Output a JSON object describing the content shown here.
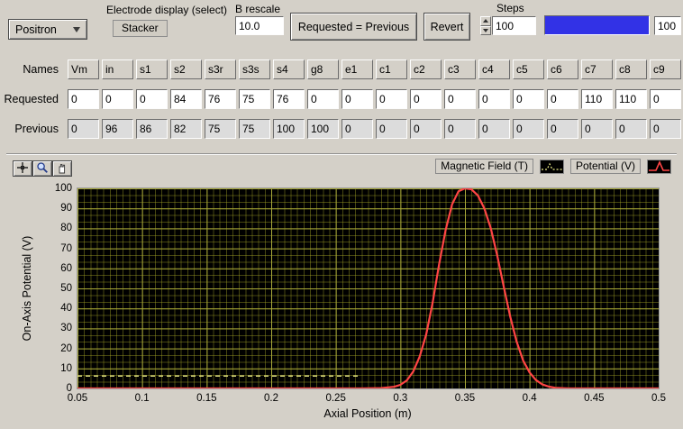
{
  "colors": {
    "panel_bg": "#d4d0c8",
    "plot_bg": "#000000",
    "grid_major": "#a9a93a",
    "grid_minor": "#5c5c14",
    "slider_blue": "#3232e6",
    "potential_red": "#ff4545",
    "bfield_yellow": "#f0f08c"
  },
  "top": {
    "particle_selector": "Positron",
    "electrode_display_label": "Electrode display (select)",
    "electrode_display_value": "Stacker",
    "b_rescale_label": "B rescale",
    "b_rescale_value": "10.0",
    "requested_equals_previous_label": "Requested = Previous",
    "revert_label": "Revert",
    "steps_label": "Steps",
    "steps_value": "100",
    "slider_value_display": "100"
  },
  "table": {
    "row_labels": [
      "Names",
      "Requested",
      "Previous"
    ],
    "names": [
      "Vm",
      "in",
      "s1",
      "s2",
      "s3r",
      "s3s",
      "s4",
      "g8",
      "e1",
      "c1",
      "c2",
      "c3",
      "c4",
      "c5",
      "c6",
      "c7",
      "c8",
      "c9"
    ],
    "requested": [
      "0",
      "0",
      "0",
      "84",
      "76",
      "75",
      "76",
      "0",
      "0",
      "0",
      "0",
      "0",
      "0",
      "0",
      "0",
      "110",
      "110",
      "0"
    ],
    "previous": [
      "0",
      "96",
      "86",
      "82",
      "75",
      "75",
      "100",
      "100",
      "0",
      "0",
      "0",
      "0",
      "0",
      "0",
      "0",
      "0",
      "0",
      "0"
    ]
  },
  "graph": {
    "legend": [
      {
        "label": "Magnetic Field (T)",
        "color": "#f0f08c",
        "style": "dashed"
      },
      {
        "label": "Potential (V)",
        "color": "#ff4545",
        "style": "solid"
      }
    ],
    "ylabel": "On-Axis Potential (V)",
    "xlabel": "Axial Position (m)",
    "yticks": [
      100,
      90,
      80,
      70,
      60,
      50,
      40,
      30,
      20,
      10,
      0
    ],
    "xticks": [
      "0.05",
      "0.1",
      "0.15",
      "0.2",
      "0.25",
      "0.3",
      "0.35",
      "0.4",
      "0.45",
      "0.5"
    ]
  },
  "chart_data": {
    "type": "line",
    "title": "",
    "xlabel": "Axial Position (m)",
    "ylabel": "On-Axis Potential (V)",
    "xlim": [
      0.05,
      0.5
    ],
    "ylim": [
      0,
      100
    ],
    "xticks": [
      0.05,
      0.1,
      0.15,
      0.2,
      0.25,
      0.3,
      0.35,
      0.4,
      0.45,
      0.5
    ],
    "yticks": [
      0,
      10,
      20,
      30,
      40,
      50,
      60,
      70,
      80,
      90,
      100
    ],
    "grid": true,
    "plot_bg": "#000000",
    "legend_position": "top-right",
    "series": [
      {
        "name": "Magnetic Field (T)",
        "color": "#f0f08c",
        "dash": [
          5,
          4
        ],
        "width": 1.4,
        "points": [
          [
            0.05,
            6.2
          ],
          [
            0.268,
            6.2
          ]
        ]
      },
      {
        "name": "Potential (V)",
        "color": "#ff4545",
        "dash": null,
        "width": 2.2,
        "points": [
          [
            0.05,
            0
          ],
          [
            0.27,
            0
          ],
          [
            0.285,
            0.2
          ],
          [
            0.295,
            0.8
          ],
          [
            0.3,
            1.8
          ],
          [
            0.305,
            4
          ],
          [
            0.31,
            8.5
          ],
          [
            0.315,
            16
          ],
          [
            0.32,
            27
          ],
          [
            0.325,
            43
          ],
          [
            0.33,
            62
          ],
          [
            0.335,
            79
          ],
          [
            0.34,
            92
          ],
          [
            0.345,
            98.5
          ],
          [
            0.35,
            100
          ],
          [
            0.355,
            99.5
          ],
          [
            0.36,
            96.5
          ],
          [
            0.365,
            90
          ],
          [
            0.37,
            80
          ],
          [
            0.375,
            66.5
          ],
          [
            0.38,
            51
          ],
          [
            0.385,
            36
          ],
          [
            0.39,
            23.5
          ],
          [
            0.395,
            14
          ],
          [
            0.4,
            8
          ],
          [
            0.405,
            4.2
          ],
          [
            0.41,
            2
          ],
          [
            0.415,
            0.9
          ],
          [
            0.42,
            0.3
          ],
          [
            0.43,
            0
          ],
          [
            0.5,
            0
          ]
        ]
      }
    ]
  }
}
